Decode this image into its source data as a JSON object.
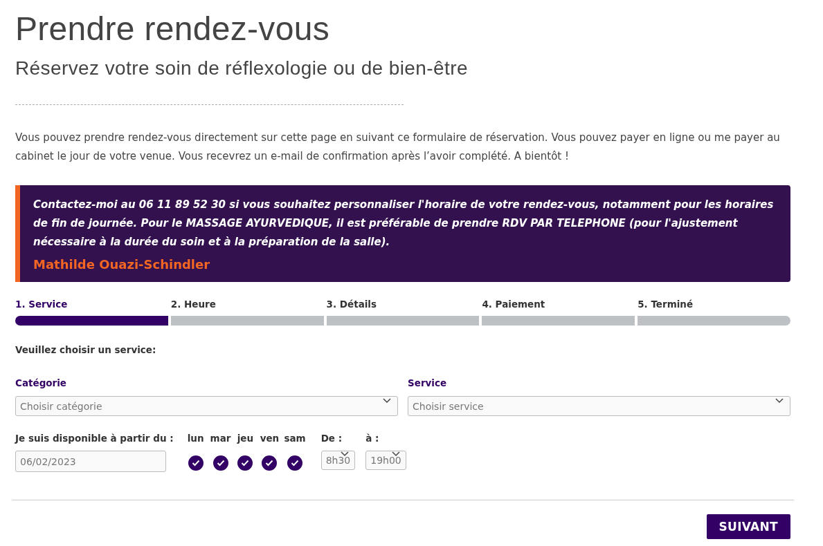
{
  "title": "Prendre rendez-vous",
  "subtitle": "Réservez votre soin de réflexologie ou de bien-être",
  "intro": "Vous pouvez prendre rendez-vous directement sur cette page en suivant ce formulaire de réservation. Vous pouvez payer en ligne ou me payer au cabinet le jour de votre venue. Vous recevrez un e-mail de confirmation après l’avoir complété. A bientôt  !",
  "notice": {
    "text": "Contactez-moi au 06 11 89 52 30 si vous souhaitez personnaliser l'horaire de votre rendez-vous, notamment pour les horaires de fin de journée. Pour le MASSAGE AYURVEDIQUE, il est préférable de prendre RDV PAR TELEPHONE (pour l'ajustement nécessaire à la durée du soin et à la préparation de la salle).",
    "author": "Mathilde Ouazi-Schindler"
  },
  "steps": [
    {
      "label": "1. Service",
      "selected": true
    },
    {
      "label": "2. Heure",
      "selected": false
    },
    {
      "label": "3. Détails",
      "selected": false
    },
    {
      "label": "4. Paiement",
      "selected": false
    },
    {
      "label": "5. Terminé",
      "selected": false
    }
  ],
  "prompt": "Veuillez choisir un service:",
  "category": {
    "label": "Catégorie",
    "placeholder": "Choisir catégorie"
  },
  "service": {
    "label": "Service",
    "placeholder": "Choisir service"
  },
  "availability": {
    "label": "Je suis disponible à partir du :",
    "value": "06/02/2023"
  },
  "days": [
    {
      "label": "lun",
      "checked": true
    },
    {
      "label": "mar",
      "checked": true
    },
    {
      "label": "jeu",
      "checked": true
    },
    {
      "label": "ven",
      "checked": true
    },
    {
      "label": "sam",
      "checked": true
    }
  ],
  "from": {
    "label": "De :",
    "value": "8h30"
  },
  "to": {
    "label": "à :",
    "value": "19h00"
  },
  "next_button": "SUIVANT"
}
